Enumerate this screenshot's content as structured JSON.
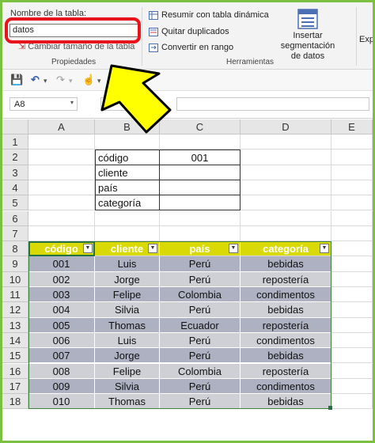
{
  "ribbon": {
    "table_name_label": "Nombre de la tabla:",
    "table_name_value": "datos",
    "resize_table_label": "Cambiar tamaño de la tabla",
    "group_properties": "Propiedades",
    "summarize_pivot": "Resumir con tabla dinámica",
    "remove_duplicates": "Quitar duplicados",
    "convert_to_range": "Convertir en rango",
    "insert_slicer_line1": "Insertar segmentación",
    "insert_slicer_line2": "de datos",
    "export_cut": "Exp",
    "group_tools": "Herramientas"
  },
  "formula_bar": {
    "name_box": "A8",
    "fx_symbol": "fx",
    "formula": ""
  },
  "columns": [
    "A",
    "B",
    "C",
    "D",
    "E"
  ],
  "rows": [
    "1",
    "2",
    "3",
    "4",
    "5",
    "6",
    "7",
    "8",
    "9",
    "10",
    "11",
    "12",
    "13",
    "14",
    "15",
    "16",
    "17",
    "18"
  ],
  "form": {
    "labels": [
      "código",
      "cliente",
      "país",
      "categoría"
    ],
    "codigo_value": "001"
  },
  "table": {
    "headers": [
      "código",
      "cliente",
      "país",
      "categoría"
    ],
    "rows": [
      [
        "001",
        "Luis",
        "Perú",
        "bebidas"
      ],
      [
        "002",
        "Jorge",
        "Perú",
        "repostería"
      ],
      [
        "003",
        "Felipe",
        "Colombia",
        "condimentos"
      ],
      [
        "004",
        "Silvia",
        "Perú",
        "bebidas"
      ],
      [
        "005",
        "Thomas",
        "Ecuador",
        "repostería"
      ],
      [
        "006",
        "Luis",
        "Perú",
        "condimentos"
      ],
      [
        "007",
        "Jorge",
        "Perú",
        "bebidas"
      ],
      [
        "008",
        "Felipe",
        "Colombia",
        "repostería"
      ],
      [
        "009",
        "Silvia",
        "Perú",
        "condimentos"
      ],
      [
        "010",
        "Thomas",
        "Perú",
        "bebidas"
      ]
    ]
  },
  "colors": {
    "frame_border": "#7ac142",
    "highlight_red": "#e8141b",
    "arrow_yellow": "#ffff00",
    "header_yellow": "#d9d905",
    "band_dark": "#aeb1c2",
    "band_light": "#cfd0d6"
  }
}
